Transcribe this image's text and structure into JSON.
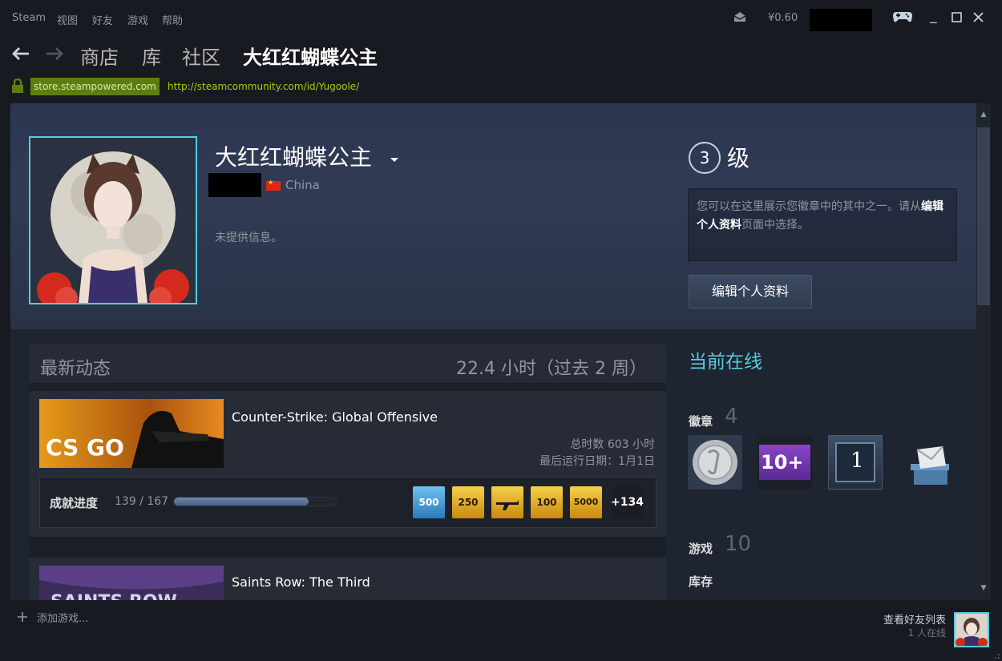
{
  "menu": {
    "items": [
      "Steam",
      "视图",
      "好友",
      "游戏",
      "帮助"
    ],
    "wallet": "¥0.60"
  },
  "nav": {
    "tabs": [
      "商店",
      "库",
      "社区"
    ],
    "active_page": "大红红蝴蝶公主"
  },
  "address": {
    "domain": "store.steampowered.com",
    "url": "http://steamcommunity.com/id/Yugoole/"
  },
  "profile": {
    "name": "大红红蝴蝶公主",
    "country": "China",
    "summary": "未提供信息。",
    "level": "3",
    "level_label": "级",
    "showcase_text_1": "您可以在这里展示您徽章中的其中之一。请从",
    "showcase_link": "编辑个人资料",
    "showcase_text_2": "页面中选择。",
    "edit_button": "编辑个人资料"
  },
  "activity": {
    "title": "最新动态",
    "hours": "22.4 小时（过去 2 周）",
    "games": [
      {
        "name": "Counter-Strike: Global Offensive",
        "capsule_text": "CS GO",
        "total_hours": "总时数 603 小时",
        "last_played": "最后运行日期：1月1日",
        "achievement_label": "成就进度",
        "achievement_count": "139 / 167",
        "achievement_progress": 0.832,
        "achievement_icons": [
          "500",
          "250",
          "",
          "100",
          "5000"
        ],
        "more": "+134"
      },
      {
        "name": "Saints Row: The Third",
        "capsule_text": "SAINTS ROW"
      }
    ]
  },
  "sidebar": {
    "status": "当前在线",
    "badges_label": "徽章",
    "badges_count": "4",
    "badges": [
      "coin-badge",
      "10+",
      "1",
      "mail-badge"
    ],
    "games_label": "游戏",
    "games_count": "10",
    "inventory_label": "库存"
  },
  "bottom": {
    "add_game": "添加游戏...",
    "friends_list": "查看好友列表",
    "online_count": "1 人在线"
  },
  "colors": {
    "accent": "#57cbde",
    "url_green": "#a4d007",
    "store_badge": "#5c7e10",
    "background": "#1b2838"
  }
}
